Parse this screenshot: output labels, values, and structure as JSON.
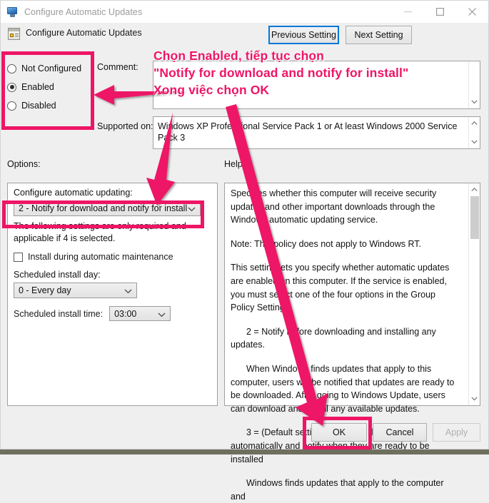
{
  "window": {
    "title": "Configure Automatic Updates",
    "icon": "computer-policy-icon",
    "minimize_label": "—",
    "maximize_label": "□",
    "close_label": "✕"
  },
  "header": {
    "title": "Configure Automatic Updates",
    "icon": "policy-setting-icon",
    "previous_setting": "Previous Setting",
    "next_setting": "Next Setting"
  },
  "state_radios": {
    "options": [
      {
        "label": "Not Configured",
        "selected": false
      },
      {
        "label": "Enabled",
        "selected": true
      },
      {
        "label": "Disabled",
        "selected": false
      }
    ]
  },
  "comment": {
    "label": "Comment:",
    "value": "",
    "scroll_down_icon": "chevron-down-icon"
  },
  "supported_on": {
    "label": "Supported on:",
    "value": "Windows XP Professional Service Pack 1 or At least Windows 2000 Service Pack 3",
    "scroll_up_icon": "chevron-up-icon",
    "scroll_down_icon": "chevron-down-icon"
  },
  "options_panel": {
    "label": "Options:",
    "configure_caption": "Configure automatic updating:",
    "configure_value": "2 - Notify for download and notify for install",
    "note": "The following settings are only required and applicable if 4 is selected.",
    "install_maintenance_label": "Install during automatic maintenance",
    "install_maintenance_checked": false,
    "scheduled_day_label": "Scheduled install day:",
    "scheduled_day_value": "0 - Every day",
    "scheduled_time_label": "Scheduled install time:",
    "scheduled_time_value": "03:00",
    "dropdown_icon": "chevron-down-icon"
  },
  "help_panel": {
    "label": "Help:",
    "paragraphs": [
      "Specifies whether this computer will receive security updates and other important downloads through the Windows automatic updating service.",
      "Note: This policy does not apply to Windows RT.",
      "This setting lets you specify whether automatic updates are enabled on this computer. If the service is enabled, you must select one of the four options in the Group Policy Setting:",
      "2 = Notify before downloading and installing any updates.",
      "When Windows finds updates that apply to this computer, users will be notified that updates are ready to be downloaded. After going to Windows Update, users can download and install any available updates.",
      "3 = (Default setting) Download the updates automatically and notify when they are ready to be installed",
      "Windows finds updates that apply to the computer and"
    ],
    "scroll_up_icon": "chevron-up-icon",
    "scroll_down_icon": "chevron-down-icon"
  },
  "footer": {
    "ok": "OK",
    "cancel": "Cancel",
    "apply": "Apply",
    "apply_enabled": false
  },
  "annotation": {
    "line1": "Chọn Enabled, tiếp tục chọn",
    "line2": "\"Notify for download and notify for install\"",
    "line3": "Xong việc chọn OK",
    "color": "#EE1566",
    "highlight_targets": [
      "state-radios-group",
      "configure-updating-dropdown",
      "ok-button"
    ]
  }
}
